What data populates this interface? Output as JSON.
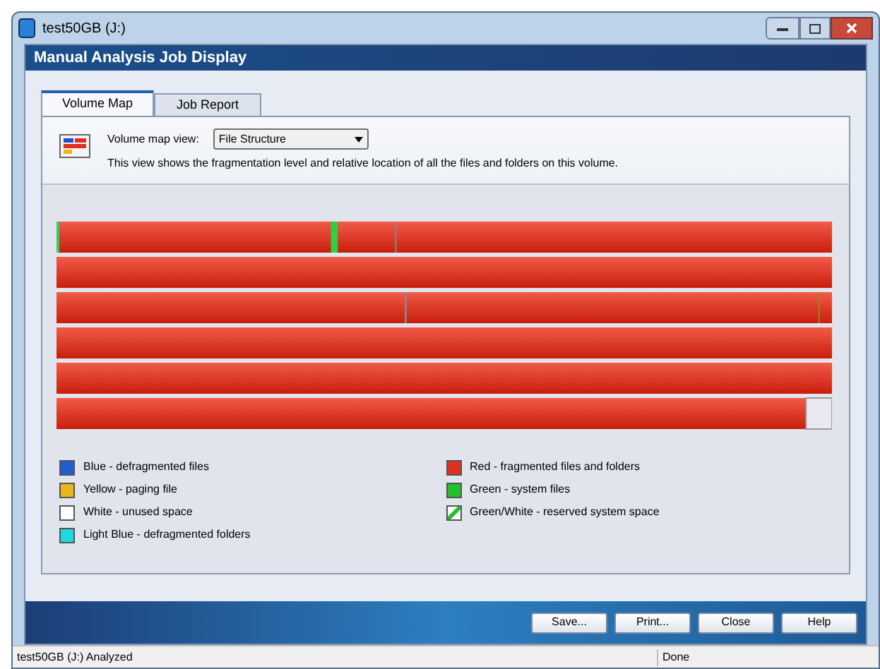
{
  "window": {
    "title": "test50GB (J:)"
  },
  "dialog": {
    "title": "Manual Analysis Job Display"
  },
  "tabs": [
    {
      "label": "Volume Map",
      "selected": true
    },
    {
      "label": "Job Report",
      "selected": false
    }
  ],
  "view": {
    "label": "Volume map view:",
    "value": "File Structure",
    "description": "This view shows the fragmentation level and relative location of all the files and folders on this volume."
  },
  "legend": [
    {
      "label": "Blue - defragmented files",
      "color": "#1f5fcf",
      "kind": "solid"
    },
    {
      "label": "Yellow - paging file",
      "color": "#e8b81a",
      "kind": "solid"
    },
    {
      "label": "White - unused space",
      "color": "#ffffff",
      "kind": "solid"
    },
    {
      "label": "Light Blue - defragmented folders",
      "color": "#20d8e0",
      "kind": "solid"
    },
    {
      "label": "Red - fragmented files and folders",
      "color": "#e0301e",
      "kind": "solid"
    },
    {
      "label": "Green - system files",
      "color": "#22c02a",
      "kind": "solid"
    },
    {
      "label": "Green/White - reserved system space",
      "color": "#22c02a",
      "kind": "hatched"
    }
  ],
  "buttons": [
    "Save...",
    "Print...",
    "Close",
    "Help"
  ],
  "status_bar": {
    "message": "test50GB (J:) Analyzed",
    "state": "Done"
  }
}
